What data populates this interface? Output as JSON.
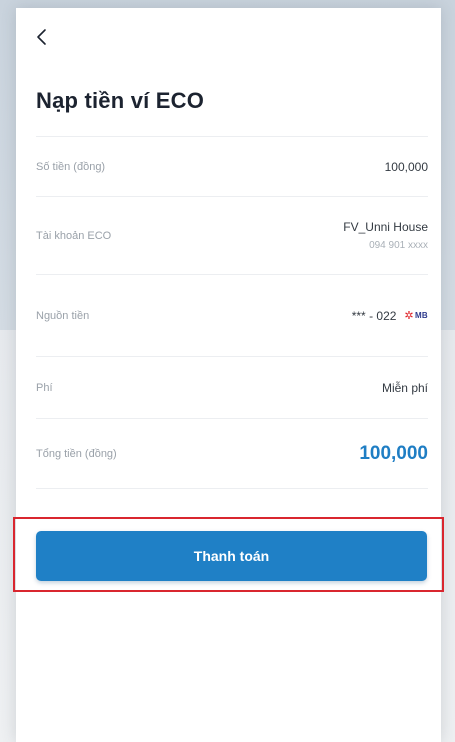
{
  "header": {
    "back_icon": "chevron-left-icon",
    "title": "Nạp tiền ví ECO"
  },
  "details": {
    "amount": {
      "label": "Số tiền (đồng)",
      "value": "100,000"
    },
    "eco_account": {
      "label": "Tài khoản ECO",
      "name": "FV_Unni House",
      "phone": "094 901 xxxx"
    },
    "source": {
      "label": "Nguồn tiền",
      "value": "*** - 022",
      "bank_logo_text": "MB",
      "bank_logo_icon": "mb-bank-logo"
    },
    "fee": {
      "label": "Phí",
      "value": "Miễn phí"
    },
    "total": {
      "label": "Tổng tiền (đồng)",
      "value": "100,000"
    }
  },
  "actions": {
    "pay_label": "Thanh toán"
  },
  "colors": {
    "accent": "#1f80c6",
    "total_text": "#1f7ec4",
    "highlight_border": "#d9262f",
    "bank_star": "#e0262b",
    "bank_text": "#2d3a8c"
  }
}
